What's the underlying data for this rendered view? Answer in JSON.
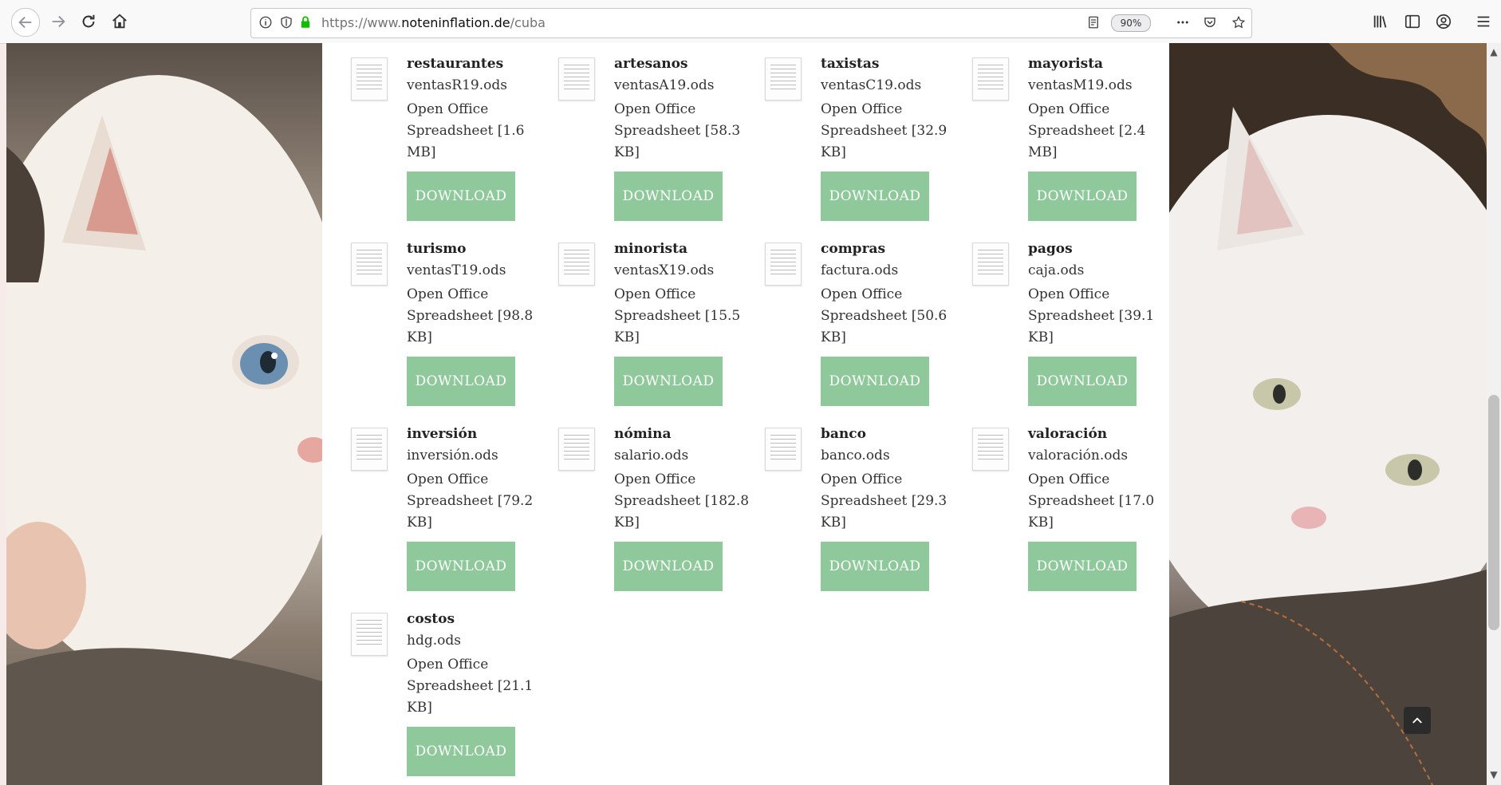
{
  "browser": {
    "url_prefix": "https://www.",
    "url_domain": "noteninflation.de",
    "url_path": "/cuba",
    "zoom": "90%"
  },
  "colors": {
    "download_button_bg": "#8fc99b",
    "content_bg": "#ffffff"
  },
  "files": [
    {
      "title": "restaurantes",
      "file": "ventasR19.ods",
      "desc": "Open Office Spreadsheet [1.6 MB]",
      "button": "DOWNLOAD"
    },
    {
      "title": "artesanos",
      "file": "ventasA19.ods",
      "desc": "Open Office Spreadsheet [58.3 KB]",
      "button": "DOWNLOAD"
    },
    {
      "title": "taxistas",
      "file": "ventasC19.ods",
      "desc": "Open Office Spreadsheet [32.9 KB]",
      "button": "DOWNLOAD"
    },
    {
      "title": "mayorista",
      "file": "ventasM19.ods",
      "desc": "Open Office Spreadsheet [2.4 MB]",
      "button": "DOWNLOAD"
    },
    {
      "title": "turismo",
      "file": "ventasT19.ods",
      "desc": "Open Office Spreadsheet [98.8 KB]",
      "button": "DOWNLOAD"
    },
    {
      "title": "minorista",
      "file": "ventasX19.ods",
      "desc": "Open Office Spreadsheet [15.5 KB]",
      "button": "DOWNLOAD"
    },
    {
      "title": "compras",
      "file": "factura.ods",
      "desc": "Open Office Spreadsheet [50.6 KB]",
      "button": "DOWNLOAD"
    },
    {
      "title": "pagos",
      "file": "caja.ods",
      "desc": "Open Office Spreadsheet [39.1 KB]",
      "button": "DOWNLOAD"
    },
    {
      "title": "inversión",
      "file": "inversión.ods",
      "desc": "Open Office Spreadsheet [79.2 KB]",
      "button": "DOWNLOAD"
    },
    {
      "title": "nómina",
      "file": "salario.ods",
      "desc": "Open Office Spreadsheet [182.8 KB]",
      "button": "DOWNLOAD"
    },
    {
      "title": "banco",
      "file": "banco.ods",
      "desc": "Open Office Spreadsheet [29.3 KB]",
      "button": "DOWNLOAD"
    },
    {
      "title": "valoración",
      "file": "valoración.ods",
      "desc": "Open Office Spreadsheet [17.0 KB]",
      "button": "DOWNLOAD"
    },
    {
      "title": "costos",
      "file": "hdg.ods",
      "desc": "Open Office Spreadsheet [21.1 KB]",
      "button": "DOWNLOAD"
    }
  ]
}
